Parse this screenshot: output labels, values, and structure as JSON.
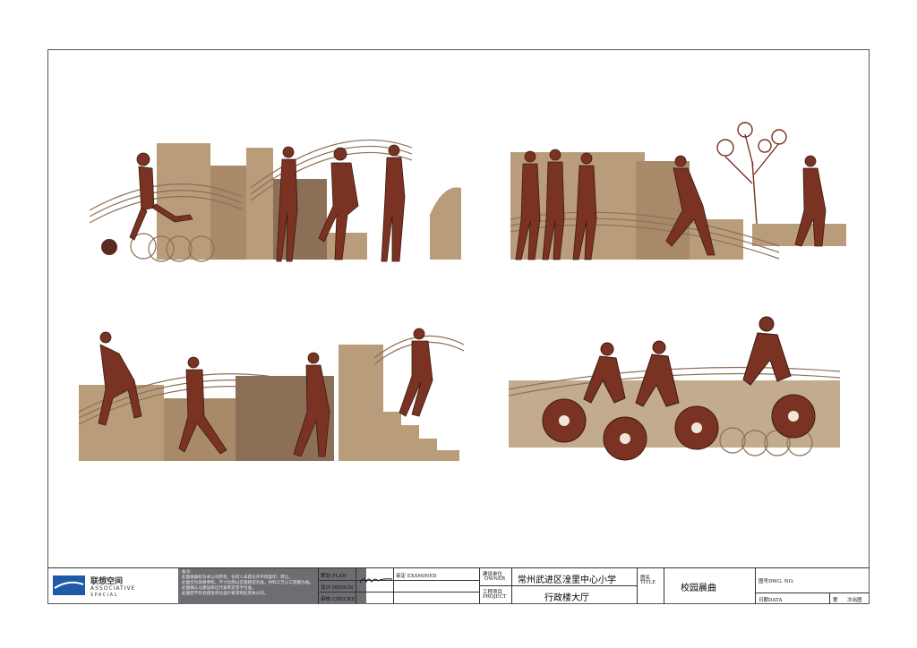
{
  "colors": {
    "rust": "#7a3222",
    "dark": "#3b1a12",
    "stone": "#b99d7a",
    "stone_dark": "#8c6f57",
    "stripe": "#a88968",
    "logo_blue": "#1e5aa8",
    "notes_bg": "#6e6e72"
  },
  "logo": {
    "cn": "联想空间",
    "en1": "ASSOCIATIVE",
    "en2": "SPACIAL"
  },
  "notes": {
    "label": "备注:",
    "lines": [
      "此图纸版权为本公司所有，任何人未获允许不得复印、转让。",
      "此图仅为效果参照，尺寸比例以实施建造为准，材料工艺以工程图为准。",
      "此图确认以建设单位代表审定签字为准。",
      "此图若不符合建设单位设计要求则追究本公司。"
    ]
  },
  "titleblock": {
    "plan_label": "策划 PLAN",
    "design_label": "设计 DESIGN",
    "checked_label": "审核 CHECKED",
    "examined_label": "审定 EXAMINED",
    "owner_label_cn": "建设单位",
    "owner_label_en": "OWNER",
    "owner_value": "常州武进区湟里中心小学",
    "project_label_cn": "工程项目",
    "project_label_en": "PROJECT",
    "project_value": "行政楼大厅",
    "title_label_cn": "图名",
    "title_label_en": "TITLE",
    "title_value": "校园晨曲",
    "dwg_label": "图号DWG. NO.",
    "date_label": "日期DATA",
    "page_prefix": "第",
    "page_suffix": "次出图"
  }
}
